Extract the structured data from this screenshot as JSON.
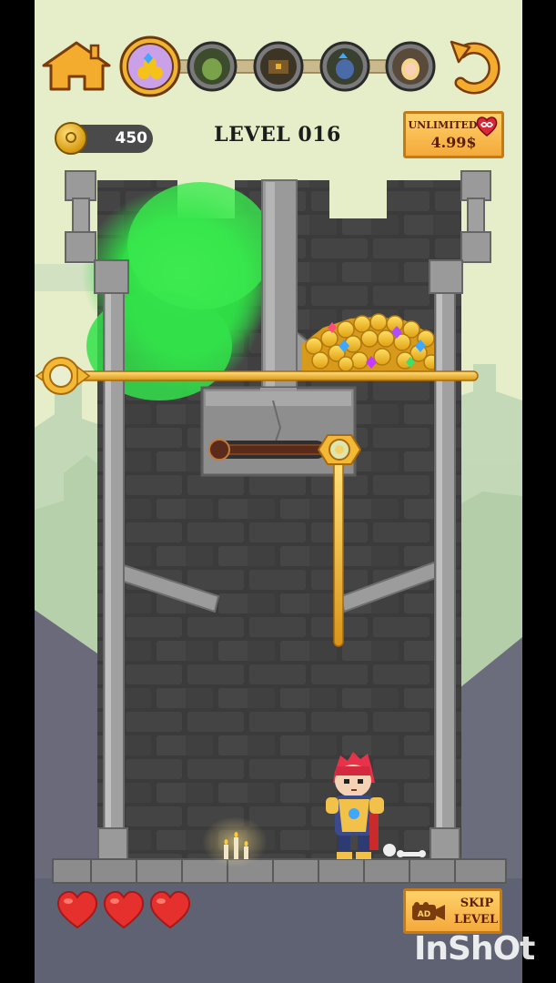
{
  "header": {
    "home_icon": "home-icon",
    "stages": [
      {
        "name": "treasure-stage-icon",
        "active": true
      },
      {
        "name": "goblin-stage-icon",
        "active": false
      },
      {
        "name": "chest-stage-icon",
        "active": false
      },
      {
        "name": "knight-stage-icon",
        "active": false
      },
      {
        "name": "princess-stage-icon",
        "active": false
      }
    ],
    "restart_icon": "restart-icon"
  },
  "coins": {
    "count": "450",
    "icon": "coin-icon"
  },
  "level": {
    "title": "LEVEL 016"
  },
  "offer": {
    "line1": "UNLIMITED",
    "price": "4.99$",
    "icon": "infinity-heart-icon"
  },
  "lives": {
    "hearts": 3,
    "max": 3,
    "icon": "heart-icon"
  },
  "skip": {
    "line1": "SKIP",
    "line2": "LEVEL",
    "badge": "AD",
    "icon": "ad-camera-icon"
  },
  "watermark": "InShOt",
  "colors": {
    "background_sky": "#e5edc9",
    "tower_stone": "#3b3b3b",
    "pin_gold": "#f0b52f",
    "gas_green": "#37e54a",
    "button_gold": "#f4a93a"
  }
}
